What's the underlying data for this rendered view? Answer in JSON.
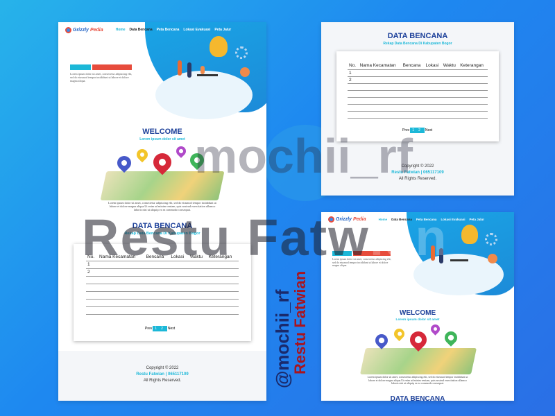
{
  "brand": {
    "name_part1": "Grizzly",
    "name_part2": "Pedia"
  },
  "nav": {
    "items": [
      "Home",
      "Data Bencana",
      "Peta Bencana",
      "Lokasi Evakuasi",
      "Peta Jalur"
    ]
  },
  "hero": {
    "text_lines": [
      "Lorem ipsum dolor sit amet, consectetur adipiscing elit,",
      "sed do eiusmod tempor incididunt ut labore et dolore",
      "magna aliqua."
    ]
  },
  "welcome": {
    "title": "WELCOME",
    "subtitle": "Lorem ipsum dolor sit amet",
    "para_lines": [
      "Lorem ipsum dolor sit amet, consectetur adipiscing elit, sed do eiusmod tempor incididunt ut",
      "labore et dolore magna aliqua.Ut enim ad minim veniam, quis nostrud exercitation ullamco",
      "laboris nisi ut aliquip ex ea commodo consequat."
    ]
  },
  "data_section": {
    "title": "DATA BENCANA",
    "subtitle": "Rekap Data Bencana Di Kabupaten Bogor",
    "columns": [
      "No.",
      "Nama Kecamatan",
      "Bencana",
      "Lokasi",
      "Waktu",
      "Keterangan"
    ],
    "rows": [
      [
        "1",
        "",
        "",
        "",
        "",
        ""
      ],
      [
        "2",
        "",
        "",
        "",
        "",
        ""
      ],
      [
        "",
        "",
        "",
        "",
        "",
        ""
      ],
      [
        "",
        "",
        "",
        "",
        "",
        ""
      ],
      [
        "",
        "",
        "",
        "",
        "",
        ""
      ],
      [
        "",
        "",
        "",
        "",
        "",
        ""
      ],
      [
        "",
        "",
        "",
        "",
        "",
        ""
      ]
    ],
    "pager": {
      "prev": "Prev",
      "pages": [
        "1",
        "2"
      ],
      "next": "Next"
    }
  },
  "footer": {
    "copyright": "Copyright © 2022",
    "author": "Restu Fatwian | 065117109",
    "rights": "All Rights Reserved."
  },
  "overlay": {
    "watermark_top": "mochii_rf",
    "watermark_big_dark": "Restu Fatw",
    "watermark_big_light": "ian",
    "vertical_handle": "@mochii_rf",
    "vertical_name": "Restu Fatwian"
  },
  "colors": {
    "accent": "#1cb8d8",
    "brand_blue": "#1b3f99",
    "red": "#e74c3c",
    "background": "#1e88f0"
  }
}
